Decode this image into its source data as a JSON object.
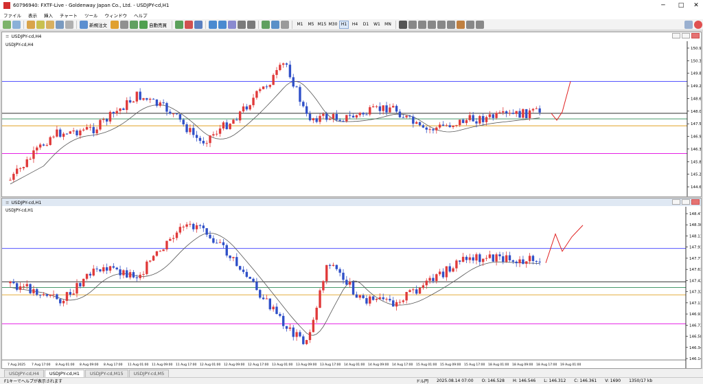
{
  "window": {
    "title": "60796940: FXTF-Live - Goldenway Japan Co., Ltd. - USDJPY-cd,H1",
    "minimize": "─",
    "maximize": "□",
    "close": "✕"
  },
  "menu": [
    "ファイル",
    "表示",
    "挿入",
    "チャート",
    "ツール",
    "ウィンドウ",
    "ヘルプ"
  ],
  "toolbar": {
    "new_order": "新規注文",
    "auto_trading": "自動売買",
    "timeframes": [
      "M1",
      "M5",
      "M15",
      "M30",
      "H1",
      "H4",
      "D1",
      "W1",
      "MN"
    ],
    "active_timeframe": "H1"
  },
  "chart_h4": {
    "window_title": "USDJPY-cd,H4",
    "symbol_label": "USDJPY-cd,H4",
    "price_ticks": [
      "150.960",
      "150.390",
      "149.815",
      "149.235",
      "148.665",
      "148.095",
      "147.520",
      "146.940",
      "146.370",
      "145.800",
      "145.210",
      "144.645"
    ],
    "line_tags": [
      {
        "label": "148.479",
        "color": "#3b3bff"
      },
      {
        "label": "147.773",
        "color": "#111111"
      },
      {
        "label": "147.630",
        "color": "#2e8b57"
      },
      {
        "label": "147.420",
        "color": "#e0a020"
      },
      {
        "label": "146.582",
        "color": "#e000e0"
      }
    ]
  },
  "chart_h1": {
    "window_title": "USDJPY-cd,H1",
    "symbol_label": "USDJPY-cd,H1",
    "price_ticks": [
      "148.479",
      "148.305",
      "148.110",
      "147.915",
      "147.773",
      "147.631",
      "147.420",
      "147.325",
      "147.130",
      "146.930",
      "146.735",
      "146.582",
      "146.340",
      "146.145"
    ],
    "time_labels": [
      "7 Aug 2025",
      "7 Aug 17:00",
      "8 Aug 01:00",
      "8 Aug 09:00",
      "8 Aug 17:00",
      "11 Aug 01:00",
      "11 Aug 09:00",
      "11 Aug 17:00",
      "12 Aug 01:00",
      "12 Aug 09:00",
      "12 Aug 17:00",
      "13 Aug 01:00",
      "13 Aug 09:00",
      "13 Aug 17:00",
      "14 Aug 01:00",
      "14 Aug 09:00",
      "14 Aug 17:00",
      "15 Aug 01:00",
      "15 Aug 09:00",
      "15 Aug 17:00",
      "18 Aug 01:00",
      "18 Aug 09:00",
      "18 Aug 17:00",
      "19 Aug 01:00"
    ],
    "line_tags": [
      {
        "label": "148.479",
        "color": "#3b3bff"
      },
      {
        "label": "147.773",
        "color": "#111111"
      },
      {
        "label": "147.631",
        "color": "#2e8b57"
      },
      {
        "label": "147.420",
        "color": "#e0a020"
      },
      {
        "label": "146.582",
        "color": "#e000e0"
      }
    ]
  },
  "tabs": [
    "USDJPY-cd,H4",
    "USDJPY-cd,H1",
    "USDJPY-cd,M15",
    "USDJPY-cd,M5"
  ],
  "active_tab": "USDJPY-cd,H1",
  "status": {
    "help": "F1キーでヘルプが表示されます",
    "profile": "ドル円",
    "datetime": "2025.08.14 07:00",
    "open": "O: 146.528",
    "high": "H: 146.546",
    "low": "L: 146.312",
    "close": "C: 146.361",
    "volume": "V: 1690",
    "traffic": "1350/17 kb"
  },
  "colors": {
    "bull": "#e03a3a",
    "bear": "#3050c8",
    "ma": "#555555",
    "projection": "#e02020"
  }
}
